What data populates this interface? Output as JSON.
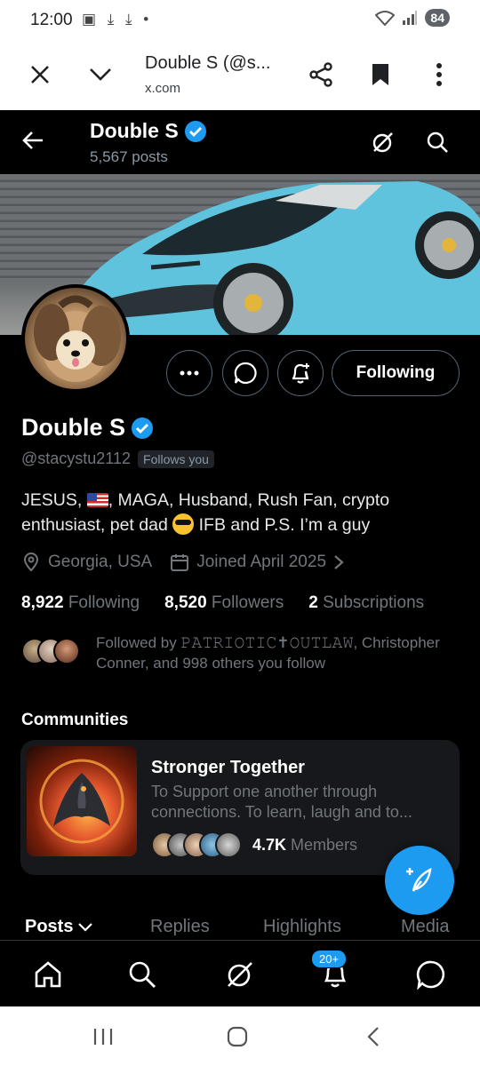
{
  "status_bar": {
    "time": "12:00",
    "notif_icons": "▣ ⤓ ⤓ •",
    "battery": "84"
  },
  "browser": {
    "page_title": "Double S (@s...",
    "url": "x.com"
  },
  "header": {
    "name": "Double S",
    "post_count": "5,567 posts"
  },
  "profile": {
    "display_name": "Double S",
    "handle": "@stacystu2112",
    "follows_you": "Follows you",
    "following_button": "Following",
    "bio_part1": "JESUS, ",
    "bio_part2": ", MAGA, Husband, Rush Fan, crypto enthusiast, pet dad ",
    "bio_part3": " IFB and P.S. I’m a guy",
    "location": "Georgia, USA",
    "joined": "Joined April 2025",
    "following_count": "8,922",
    "following_label": "Following",
    "followers_count": "8,520",
    "followers_label": "Followers",
    "subscriptions_count": "2",
    "subscriptions_label": "Subscriptions",
    "followed_by": "Followed by 𝙿𝙰𝚃𝚁𝙸𝙾𝚃𝙸𝙲✝𝙾𝚄𝚃𝙻𝙰𝚆, Christopher Conner, and 998 others you follow"
  },
  "communities": {
    "title": "Communities",
    "items": [
      {
        "name": "Stronger Together",
        "description": "To Support one another through connections. To learn, laugh and to...",
        "member_count": "4.7K",
        "member_label": "Members"
      }
    ]
  },
  "tabs": [
    "Posts",
    "Replies",
    "Highlights",
    "Media"
  ],
  "bottom_nav": {
    "notifications_badge": "20+"
  },
  "colors": {
    "accent": "#1d9bf0",
    "background": "#000000",
    "muted": "#71767b"
  }
}
